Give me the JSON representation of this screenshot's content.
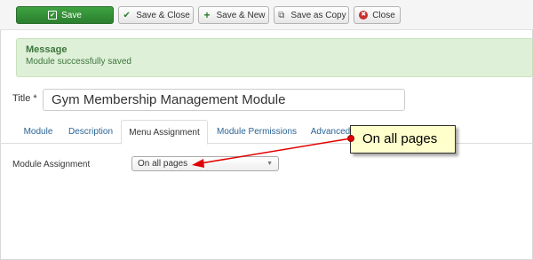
{
  "toolbar": {
    "save_label": "Save",
    "save_close_label": "Save & Close",
    "save_new_label": "Save & New",
    "save_copy_label": "Save as Copy",
    "close_label": "Close"
  },
  "message": {
    "title": "Message",
    "body": "Module successfully saved"
  },
  "form": {
    "title_label": "Title *",
    "title_value": "Gym Membership Management Module"
  },
  "tabs": [
    {
      "label": "Module",
      "active": false
    },
    {
      "label": "Description",
      "active": false
    },
    {
      "label": "Menu Assignment",
      "active": true
    },
    {
      "label": "Module Permissions",
      "active": false
    },
    {
      "label": "Advanced",
      "active": false
    }
  ],
  "assignment": {
    "label": "Module Assignment",
    "selected": "On all pages"
  },
  "callout": {
    "text": "On all pages"
  },
  "colors": {
    "save_button": "#3ea340",
    "alert_background": "#dff0d8",
    "alert_text": "#3c763d",
    "tab_link": "#2a6496",
    "callout_background": "#ffffcc",
    "arrow": "#e00000"
  }
}
